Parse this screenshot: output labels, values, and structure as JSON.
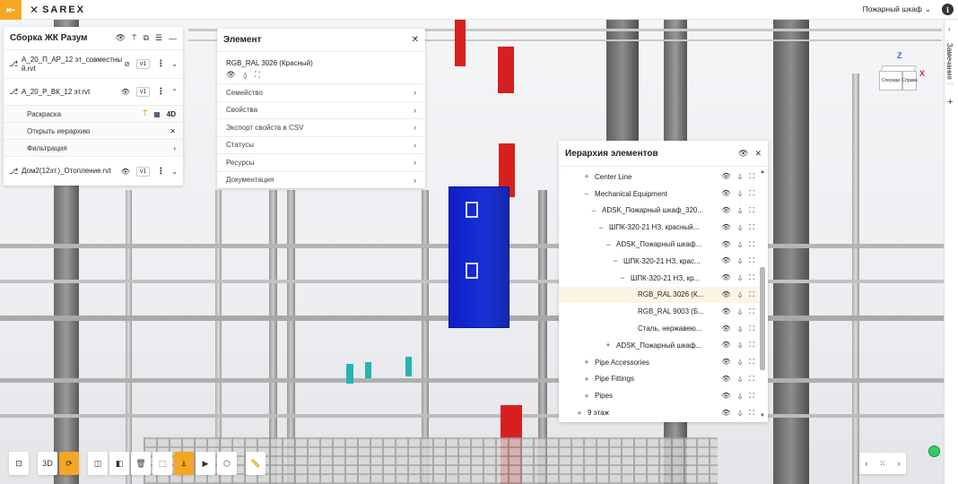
{
  "topbar": {
    "exit_icon": "exit-icon",
    "logo_mark": "✕",
    "logo_text": "SAREX",
    "project_select": "Пожарный шкаф",
    "info_label": "i"
  },
  "notes": {
    "label": "Замечания",
    "plus": "+"
  },
  "assembly": {
    "title": "Сборка ЖК Разум",
    "models": [
      {
        "name": "А_20_П_АР_12 эт_совместный.rvt",
        "version": "v1"
      },
      {
        "name": "А_20_Р_ВК_12 эт.rvt",
        "version": "v1"
      },
      {
        "name": "Дом2(12эт.)_Отопление.rvt",
        "version": "v1"
      }
    ],
    "sub_items": [
      {
        "label": "Раскраска",
        "badge": "4D"
      },
      {
        "label": "Открыть иерархию"
      },
      {
        "label": "Фильтрация"
      }
    ]
  },
  "element": {
    "title": "Элемент",
    "name": "RGB_RAL 3026 (Красный)",
    "sections": [
      "Семейство",
      "Свойства",
      "Экспорт свойств в CSV",
      "Статусы",
      "Ресурсы",
      "Документация"
    ]
  },
  "hierarchy": {
    "title": "Иерархия элементов",
    "rows": [
      {
        "label": "Center Line",
        "toggle": "+"
      },
      {
        "label": "Mechanical Equipment",
        "toggle": "−"
      },
      {
        "label": "ADSK_Пожарный шкаф_320...",
        "toggle": "−"
      },
      {
        "label": "ШПК-320-21 НЗ, красный...",
        "toggle": "−"
      },
      {
        "label": "ADSK_Пожарный шкаф...",
        "toggle": "−"
      },
      {
        "label": "ШПК-320-21 НЗ, крас...",
        "toggle": "−"
      },
      {
        "label": "ШПК-320-21 НЗ, кр...",
        "toggle": "−"
      },
      {
        "label": "RGB_RAL 3026 (К...",
        "toggle": ""
      },
      {
        "label": "RGB_RAL 9003 (Б...",
        "toggle": ""
      },
      {
        "label": "Сталь, нержавею...",
        "toggle": ""
      },
      {
        "label": "ADSK_Пожарный шкаф...",
        "toggle": "+"
      },
      {
        "label": "Pipe Accessories",
        "toggle": "+"
      },
      {
        "label": "Pipe Fittings",
        "toggle": "+"
      },
      {
        "label": "Pipes",
        "toggle": "+"
      },
      {
        "label": "9 этаж",
        "toggle": "+"
      }
    ]
  },
  "toolbar": {
    "tools": [
      "fit-view",
      "3d-view",
      "orbit",
      "section-box",
      "slice",
      "delete",
      "select-area",
      "hierarchy-tree",
      "camera",
      "cube-model",
      "measure"
    ],
    "label_3d": "3D"
  },
  "viewcube": {
    "front": "Спереди",
    "side": "Справа",
    "z": "Z",
    "x": "X"
  },
  "colors": {
    "accent": "#f5a623",
    "cabinet_blue": "#1a2fd6",
    "cabinet_red": "#d62020",
    "status_green": "#33cc66"
  }
}
